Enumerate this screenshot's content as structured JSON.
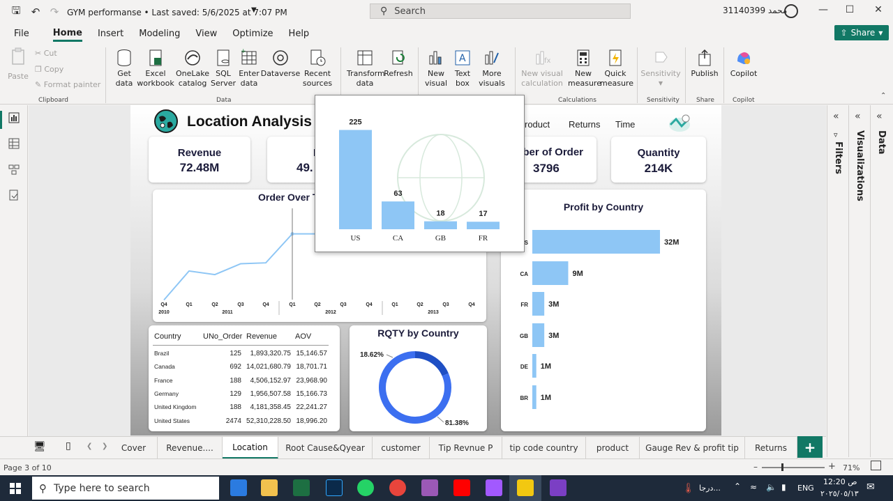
{
  "window": {
    "title": "GYM performanse  •  Last saved: 5/6/2025 at 7:07 PM",
    "search_label": "Search",
    "user_name": "محمد 31140399"
  },
  "menu": {
    "items": [
      "File",
      "Home",
      "Insert",
      "Modeling",
      "View",
      "Optimize",
      "Help"
    ],
    "active": "Home",
    "share_label": "Share"
  },
  "ribbon": {
    "paste": "Paste",
    "cut": "Cut",
    "copy": "Copy",
    "format_painter": "Format painter",
    "clipboard_group": "Clipboard",
    "get_data": "Get data",
    "excel_workbook": "Excel workbook",
    "onelake_catalog": "OneLake catalog",
    "sql_server": "SQL Server",
    "enter_data": "Enter data",
    "dataverse": "Dataverse",
    "recent_sources": "Recent sources",
    "data_group": "Data",
    "transform_data": "Transform data",
    "refresh": "Refresh",
    "new_visual": "New visual",
    "text_box": "Text box",
    "more_visuals": "More visuals",
    "new_visual_calc": "New visual calculation",
    "new_measure": "New measure",
    "quick_measure": "Quick measure",
    "calculations_group": "Calculations",
    "sensitivity": "Sensitivity",
    "sensitivity_group": "Sensitivity",
    "publish": "Publish",
    "share_group": "Share",
    "copilot": "Copilot",
    "copilot_group": "Copilot"
  },
  "report": {
    "title": "Location Analysis",
    "nav_links": [
      "roduct",
      "Returns",
      "Time"
    ],
    "kpis": [
      {
        "label": "Revenue",
        "value": "72.48M"
      },
      {
        "label": "Pr",
        "value": "49."
      },
      {
        "label": "mber of Order",
        "value": "3796"
      },
      {
        "label": "Quantity",
        "value": "214K"
      }
    ],
    "line_chart_title": "Order Over T",
    "profit_chart_title": "Profit by Country",
    "donut_title": "RQTY by Country",
    "donut_labels": [
      "18.62%",
      "81.38%"
    ]
  },
  "table": {
    "headers": [
      "Country",
      "UNo_Order",
      "Revenue",
      "AOV"
    ],
    "rows": [
      [
        "Brazil",
        "125",
        "1,893,320.75",
        "15,146.57"
      ],
      [
        "Canada",
        "692",
        "14,021,680.79",
        "18,701.71"
      ],
      [
        "France",
        "188",
        "4,506,152.97",
        "23,968.90"
      ],
      [
        "Germany",
        "129",
        "1,956,507.58",
        "15,166.73"
      ],
      [
        "United Kingdom",
        "188",
        "4,181,358.45",
        "22,241.27"
      ],
      [
        "United States",
        "2474",
        "52,310,228.50",
        "18,996.20"
      ]
    ]
  },
  "chart_data": [
    {
      "type": "bar",
      "title": "",
      "categories": [
        "US",
        "CA",
        "GB",
        "FR"
      ],
      "values": [
        225,
        63,
        18,
        17
      ],
      "data_labels": [
        "225",
        "63",
        "18",
        "17"
      ],
      "ylim": [
        0,
        240
      ],
      "color": "#8ec6f5"
    },
    {
      "type": "bar",
      "orientation": "horizontal",
      "title": "Profit by Country",
      "categories": [
        "S",
        "CA",
        "FR",
        "GB",
        "DE",
        "BR"
      ],
      "values": [
        32,
        9,
        3,
        3,
        1,
        1
      ],
      "data_labels": [
        "32M",
        "9M",
        "3M",
        "3M",
        "1M",
        "1M"
      ],
      "color": "#8ec6f5"
    },
    {
      "type": "line",
      "title": "Order Over T",
      "x_ticks": [
        "Q4",
        "Q1",
        "Q2",
        "Q3",
        "Q4",
        "Q1",
        "Q2",
        "Q3",
        "Q4",
        "Q1",
        "Q2",
        "Q3",
        "Q4"
      ],
      "x_years": [
        "2010",
        "2011",
        "2012",
        "2013"
      ],
      "values": [
        5,
        37,
        33,
        45,
        46,
        78,
        78
      ],
      "ylim": [
        0,
        100
      ],
      "color": "#8ec6f5"
    },
    {
      "type": "pie",
      "title": "RQTY by Country",
      "values": [
        18.62,
        81.38
      ],
      "labels": [
        "18.62%",
        "81.38%"
      ],
      "colors": [
        "#1f4fc4",
        "#3c6ff0"
      ]
    }
  ],
  "right_panes": {
    "filters": "Filters",
    "visualizations": "Visualizations",
    "data": "Data"
  },
  "tabs": {
    "items": [
      "Cover",
      "Revenue....",
      "Location",
      "Root Cause&Qyear",
      "customer",
      "Tip Revnue P",
      "tip code country",
      "product",
      "Gauge Rev & profit tip",
      "Returns"
    ],
    "active": "Location"
  },
  "status": {
    "page": "Page 3 of 10",
    "zoom": "71%"
  },
  "taskbar": {
    "search_placeholder": "Type here to search",
    "lang": "ENG",
    "time": "12:20 ص",
    "date": "٢٠٢٥/٠٥/١٣",
    "weather": "درجا..."
  }
}
